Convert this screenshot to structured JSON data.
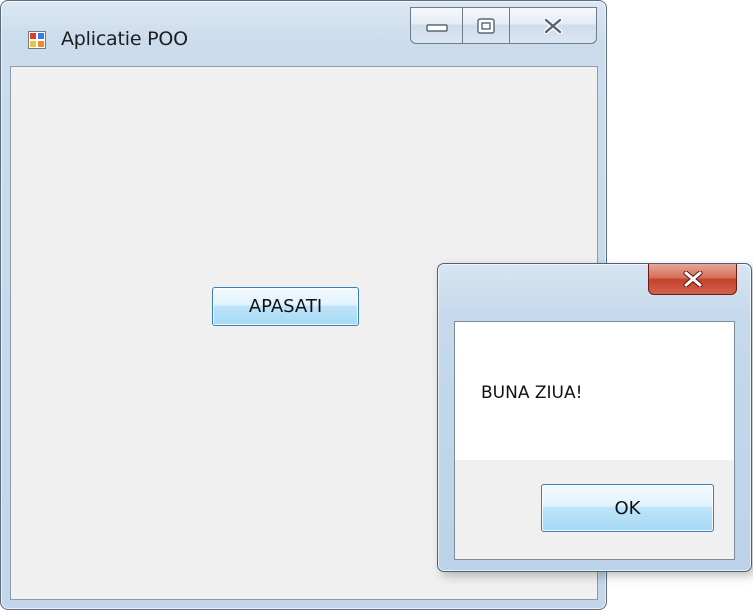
{
  "main_window": {
    "title": "Aplicatie POO",
    "icon": "app-window-icon",
    "caption_buttons": [
      "minimize-icon",
      "maximize-icon",
      "close-icon"
    ],
    "button_label": "APASATI"
  },
  "message_box": {
    "close_icon": "close-icon",
    "message": "BUNA ZIUA!",
    "ok_label": "OK"
  },
  "colors": {
    "frame": "#c3d6ea",
    "client_background": "#f0f0f0",
    "button_border": "#3c7fb1",
    "close_red": "#c4422c"
  }
}
